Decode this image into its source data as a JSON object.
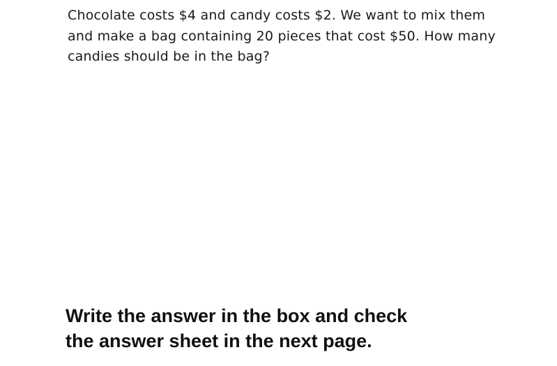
{
  "question": {
    "lines": [
      "Chocolate costs $4 and candy costs $2. We want to mix them",
      "and make a bag containing 20 pieces that cost $50. How many",
      "candies should be in the bag?"
    ]
  },
  "instruction": {
    "lines": [
      "Write the answer in the box and check",
      "the answer sheet in the next page."
    ]
  }
}
